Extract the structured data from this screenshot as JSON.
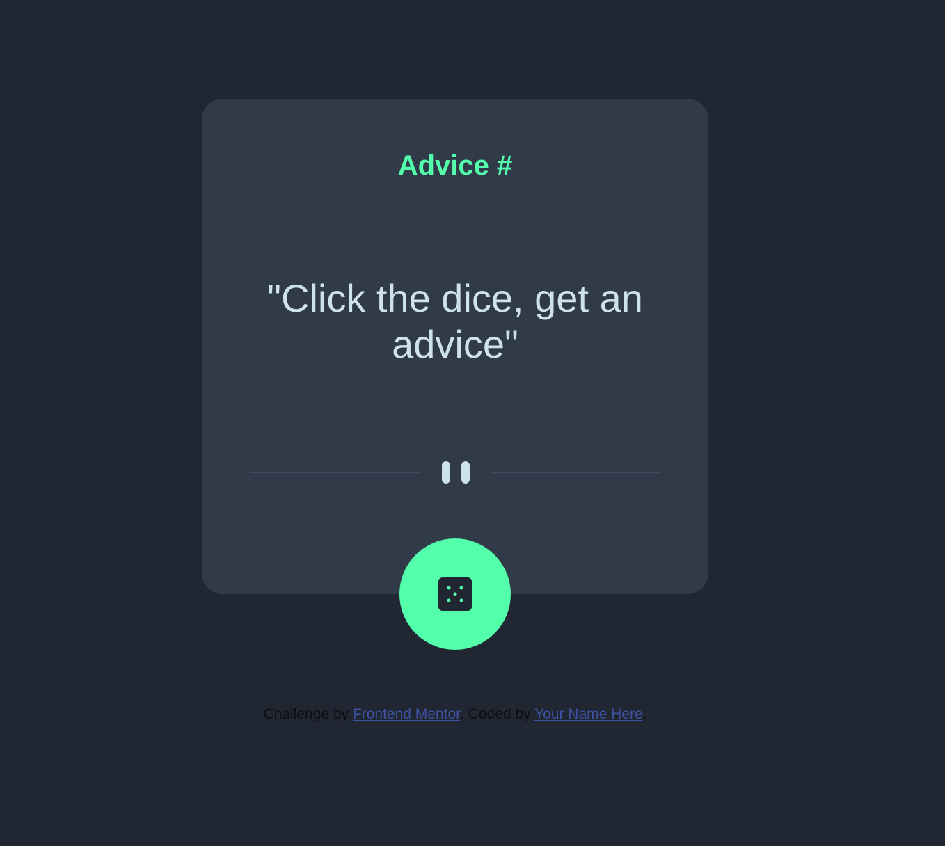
{
  "card": {
    "advice_id_label": "Advice #",
    "advice_text": "\"Click the dice, get an advice\""
  },
  "dice_button": {
    "icon": "dice-icon"
  },
  "divider": {
    "icon": "pause-icon"
  },
  "footer": {
    "challenge_by": "Challenge by ",
    "frontend_mentor_link": "Frontend Mentor",
    "coded_by": ". Coded by ",
    "author_link": "Your Name Here",
    "end": "."
  },
  "colors": {
    "background": "#202632",
    "card": "#313a49",
    "accent": "#53ffaa",
    "text": "#cee3e9",
    "link": "#3e52a3"
  }
}
